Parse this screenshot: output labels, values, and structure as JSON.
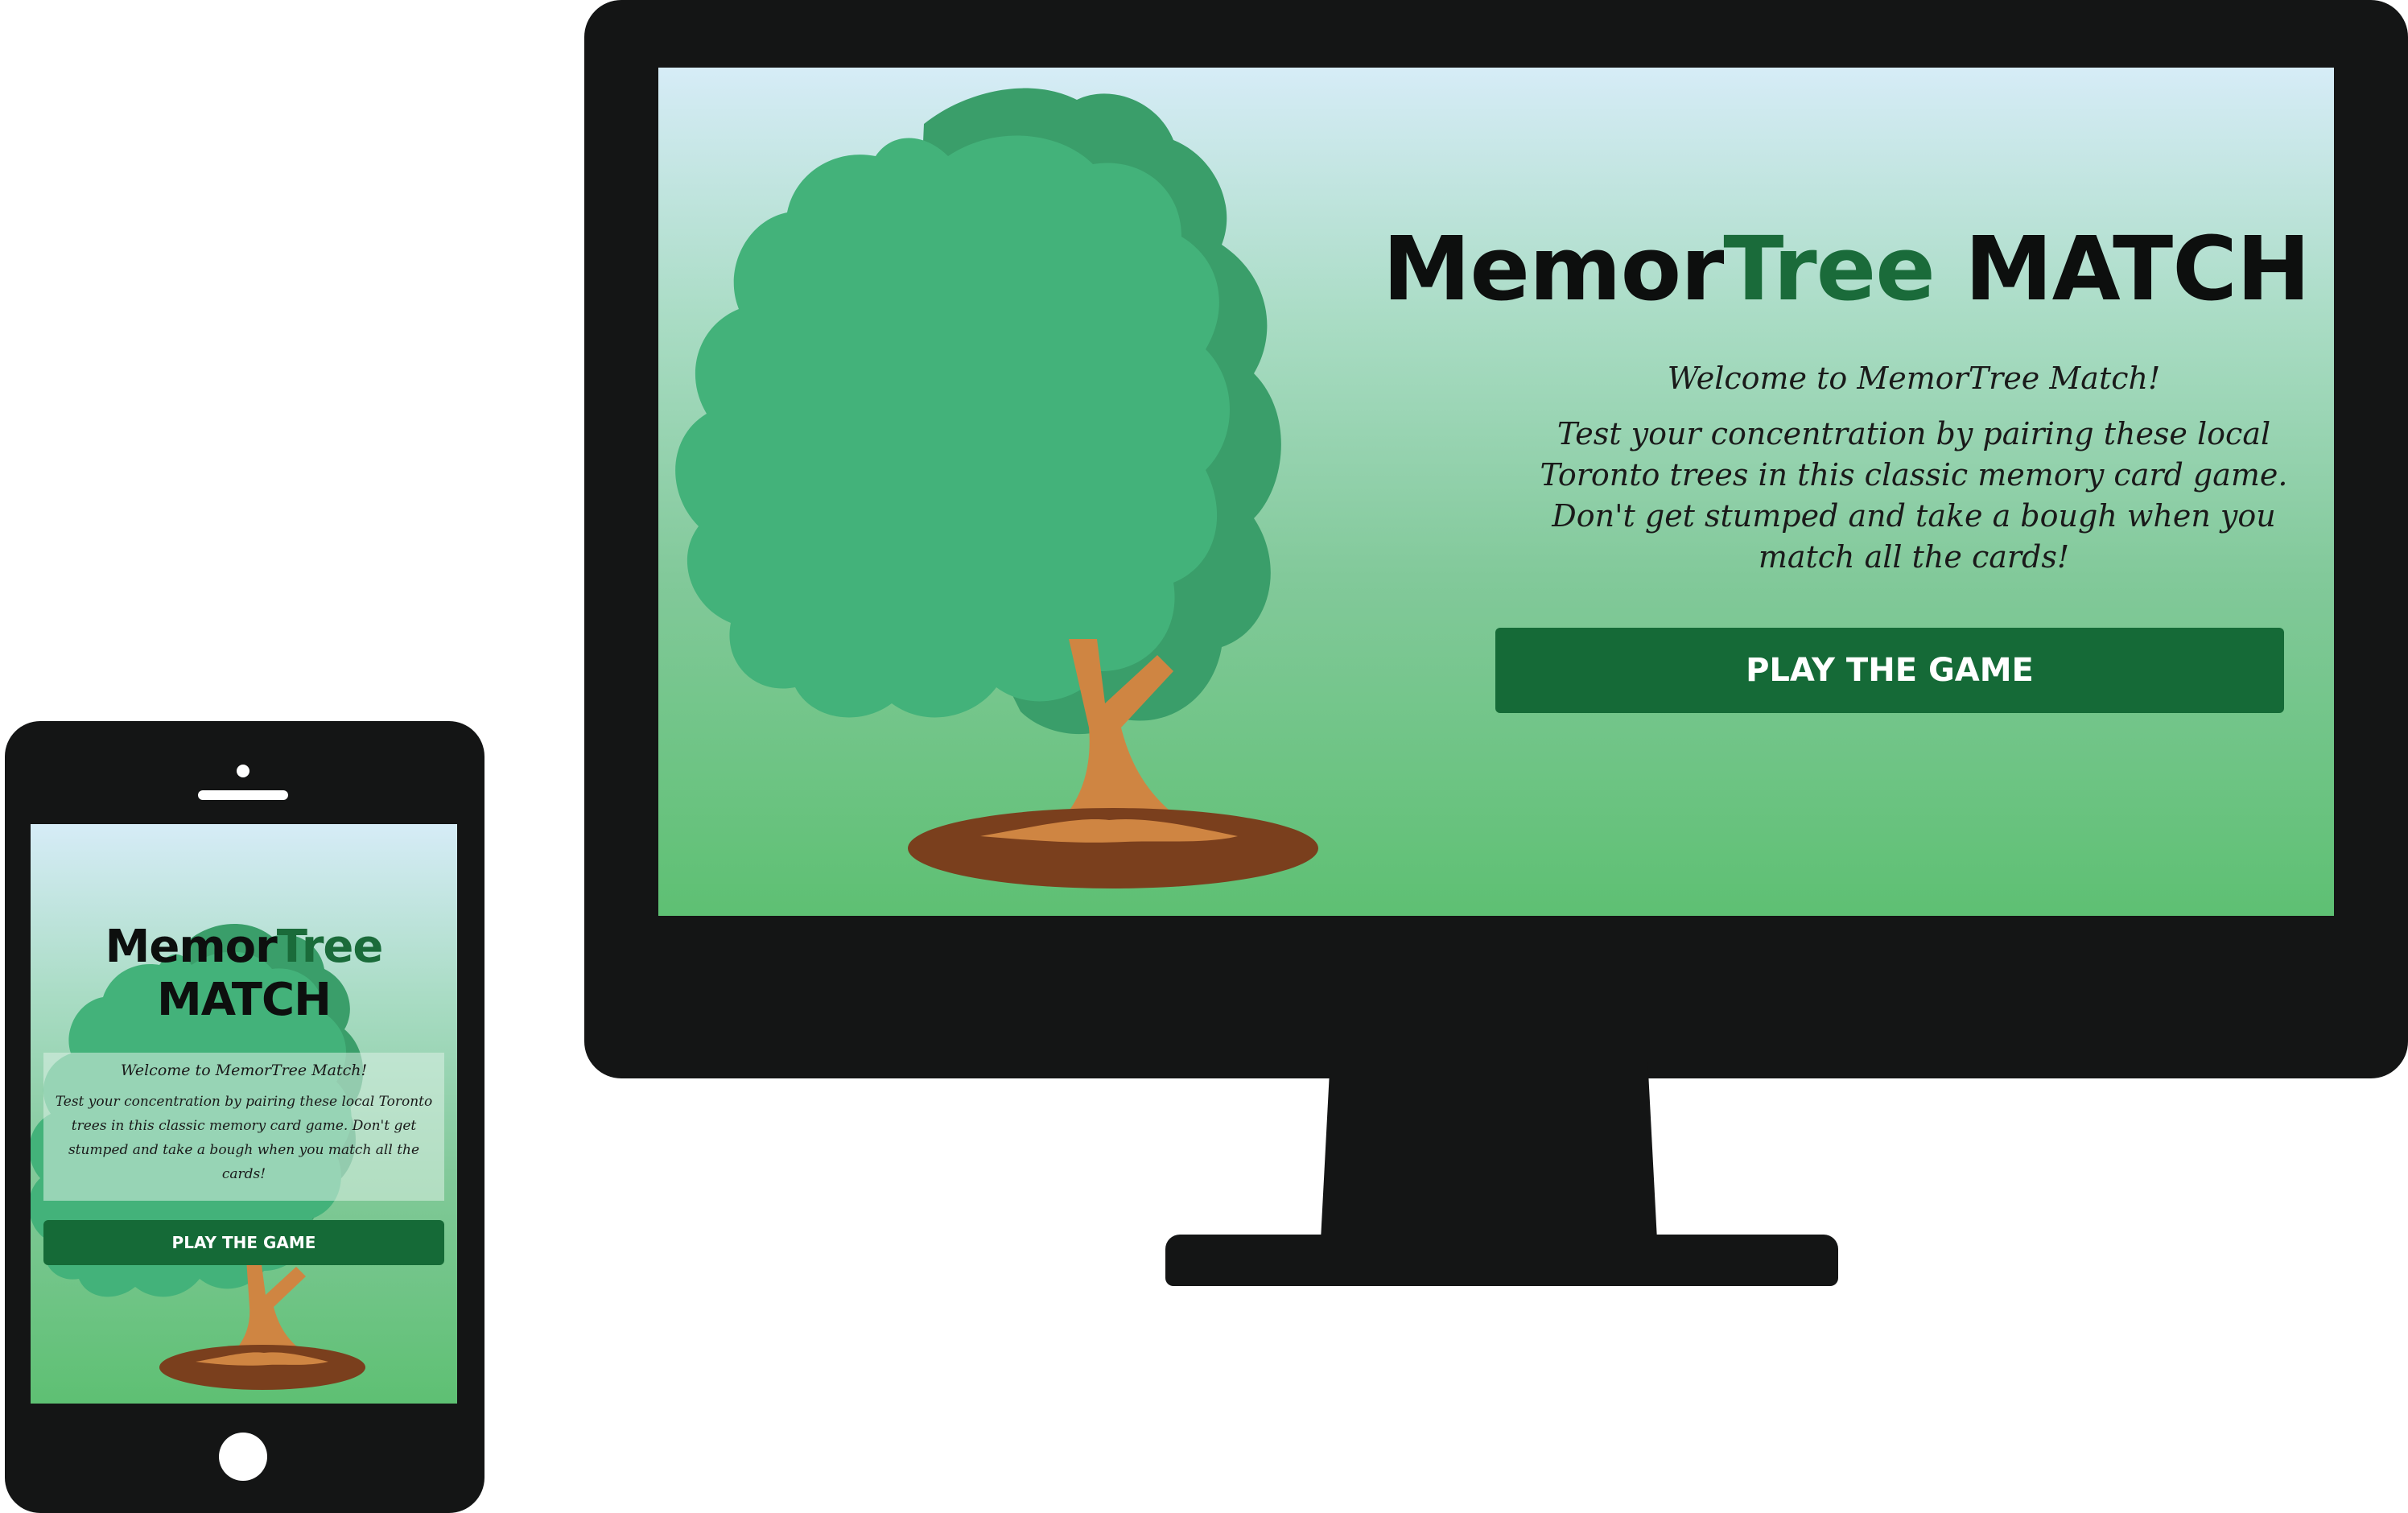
{
  "desktop": {
    "title_part1": "MemorTree ",
    "title_part1a": "Memor",
    "title_accent": "Tree",
    "title_part2": " MATCH",
    "welcome": "Welcome to MemorTree Match!",
    "description": "Test your concentration by pairing these local Toronto trees in this classic memory card game. Don't get stumped and take a bough when you match all the cards!",
    "play_button": "PLAY THE GAME"
  },
  "phone": {
    "title_part1a": "Memor",
    "title_accent": "Tree",
    "title_part2": "MATCH",
    "welcome": "Welcome to MemorTree Match!",
    "description": "Test your concentration by pairing these local Toronto trees in this classic memory card game. Don't get stumped and take a bough when you match all the cards!",
    "play_button": "PLAY THE GAME"
  },
  "colors": {
    "bezel": "#141515",
    "button_bg": "#156a37",
    "title_accent": "#1a6b3a",
    "foliage_front": "#43b27a",
    "foliage_back": "#3a9e6a",
    "trunk": "#cf8542",
    "soil": "#7a3f1d"
  },
  "icons": {
    "illustration": "tree-illustration"
  }
}
